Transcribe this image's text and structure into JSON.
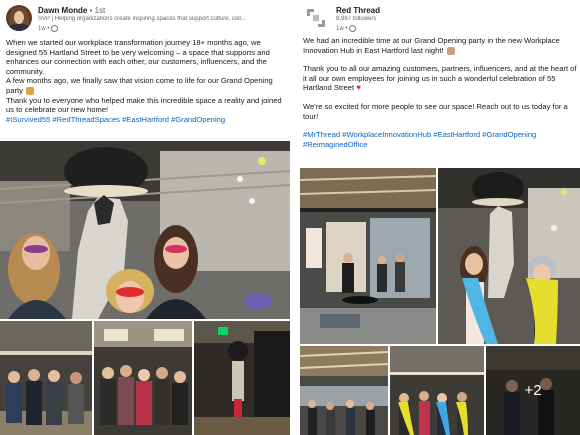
{
  "left_post": {
    "author": "Dawn Monde",
    "degree": "• 1st",
    "headline": "SVP | Helping organizations create inspiring spaces that support culture, coll...",
    "time": "1w •",
    "paragraphs": [
      "When we started our workplace transformation journey 18+ months ago, we designed 55 Hartland Street to be very welcoming – a space that supports and enhances our connection with each other, our customers, influencers, and the community.",
      "A few months ago, we finally saw that vision come to life for our Grand Opening party",
      "Thank you to everyone who helped make this incredible space a reality and joined us to celebrate our new home!"
    ],
    "hashtags": "#ISurvived55 #RedThreadSpaces #EastHartford #GrandOpening",
    "party_emoji": "party-popper-icon"
  },
  "right_post": {
    "author": "Red Thread",
    "followers": "8,987 followers",
    "time": "1w •",
    "paragraphs": [
      "We had an incredible time at our Grand Opening party in the new Workplace Innovation Hub in East Hartford last night!",
      "Thank you to all our amazing customers, partners, influencers, and at the heart of it all our own employees for joining us in such a wonderful celebration of 55 Hartland Street",
      "We're so excited for more people to see our space! Reach out to us today for a tour!"
    ],
    "hashtags": "#MrThread #WorkplaceInnovationHub #EastHartford #GrandOpening #ReimaginedOffice",
    "more_photos": "+2"
  },
  "colors": {
    "link": "#0a66c2",
    "text": "#191919",
    "muted": "#666666",
    "heart": "#e0245e"
  }
}
